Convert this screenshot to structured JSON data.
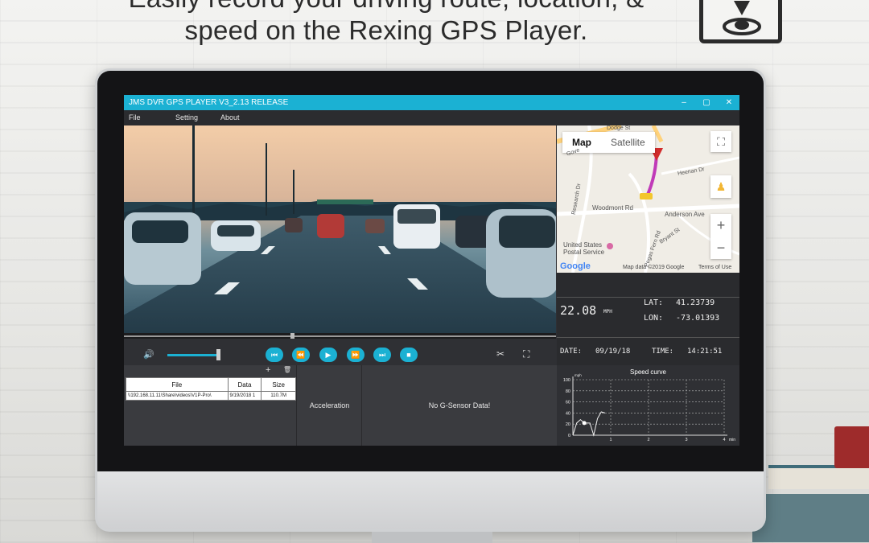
{
  "headline": {
    "line1": "Easily record your driving route, location, &",
    "line2": "speed on the Rexing GPS Player."
  },
  "window": {
    "title": "JMS DVR GPS PLAYER V3_2.13 RELEASE",
    "controls": [
      "–",
      "▢",
      "✕"
    ]
  },
  "menu": [
    "File",
    "Setting",
    "About"
  ],
  "map": {
    "tab_map": "Map",
    "tab_satellite": "Satellite",
    "labels": {
      "woodmont": "Woodmont Rd",
      "anderson": "Anderson Ave",
      "usps": "United States\nPostal Service",
      "heenan": "Heenan Dr",
      "research": "Research Dr",
      "bryant": "Bryant St",
      "peggy": "Pegas Fern Rd",
      "gove": "Gove",
      "dodge": "Dodge St"
    },
    "google": "Google",
    "attribution": "Map data ©2019 Google",
    "terms": "Terms of Use",
    "zoom_in": "+",
    "zoom_out": "−"
  },
  "gps": {
    "speed": "22.08",
    "speed_unit": "MPH",
    "lat_label": "LAT:",
    "lat": "41.23739",
    "lon_label": "LON:",
    "lon": "-73.01393",
    "date_label": "DATE:",
    "date": "09/19/18",
    "time_label": "TIME:",
    "time": "14:21:51"
  },
  "player": {
    "seek_fraction": 0.39,
    "volume_fraction": 1.0,
    "buttons": [
      "prev-file",
      "rewind",
      "play",
      "fast-forward",
      "next-file",
      "stop"
    ]
  },
  "files": {
    "columns": [
      "File",
      "Data",
      "Size"
    ],
    "rows": [
      [
        "\\\\192.168.11.11\\Share\\videos\\V1P-Pro\\",
        "9/19/2018 1",
        "110.7M"
      ]
    ],
    "add_icon": "+",
    "delete_icon": "🗑"
  },
  "acceleration_label": "Acceleration",
  "gsensor_message": "No G-Sensor Data!",
  "chart_data": {
    "type": "line",
    "title": "Speed curve",
    "ylabel": "mph",
    "xlabel": "min",
    "y_ticks": [
      0,
      20,
      40,
      60,
      80,
      100
    ],
    "x_ticks": [
      1,
      2,
      3,
      4
    ],
    "ylim": [
      0,
      100
    ],
    "xlim": [
      0,
      4
    ],
    "grid": true,
    "series": [
      {
        "x": [
          0,
          0.1,
          0.2,
          0.3,
          0.45,
          0.55,
          0.65,
          0.75,
          0.85
        ],
        "y": [
          0,
          22,
          28,
          22,
          22,
          0,
          30,
          42,
          40
        ]
      }
    ],
    "marker": {
      "x": 0.3,
      "y": 22
    }
  }
}
